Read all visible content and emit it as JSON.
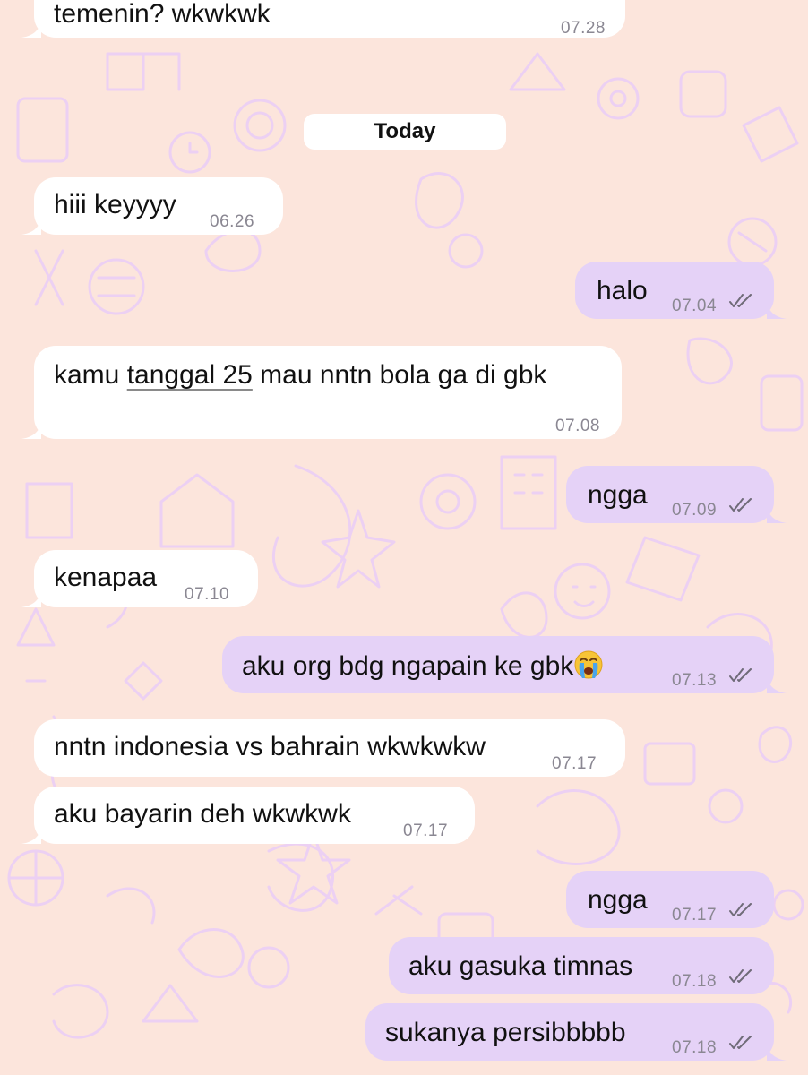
{
  "date_separator": "Today",
  "messages": [
    {
      "dir": "in",
      "text": "temenin? wkwkwk",
      "time": "07.28"
    },
    {
      "dir": "in",
      "text": "hiii keyyyy",
      "time": "06.26"
    },
    {
      "dir": "out",
      "text": "halo",
      "time": "07.04",
      "status": "read"
    },
    {
      "dir": "in",
      "text_pre": "kamu ",
      "text_link": "tanggal 25",
      "text_post": " mau nntn bola ga di gbk",
      "time": "07.08"
    },
    {
      "dir": "out",
      "text": "ngga",
      "time": "07.09",
      "status": "read"
    },
    {
      "dir": "in",
      "text": "kenapaa",
      "time": "07.10"
    },
    {
      "dir": "out",
      "text": "aku org bdg ngapain ke gbk",
      "emoji": "loudly-crying-face",
      "time": "07.13",
      "status": "read"
    },
    {
      "dir": "in",
      "text": "nntn indonesia vs bahrain wkwkwkw",
      "time": "07.17"
    },
    {
      "dir": "in",
      "text": "aku bayarin deh wkwkwk",
      "time": "07.17"
    },
    {
      "dir": "out",
      "text": "ngga",
      "time": "07.17",
      "status": "read"
    },
    {
      "dir": "out",
      "text": "aku gasuka timnas",
      "time": "07.18",
      "status": "read"
    },
    {
      "dir": "out",
      "text": "sukanya persibbbbb",
      "time": "07.18",
      "status": "read"
    }
  ],
  "colors": {
    "background": "#fce5dc",
    "incoming_bubble": "#ffffff",
    "outgoing_bubble": "#e5d2f7",
    "timestamp": "#8a8792",
    "doodle": "#ead0f5"
  },
  "icons": {
    "read_receipt": "double-check-icon",
    "emoji": "loudly-crying-face-emoji"
  }
}
